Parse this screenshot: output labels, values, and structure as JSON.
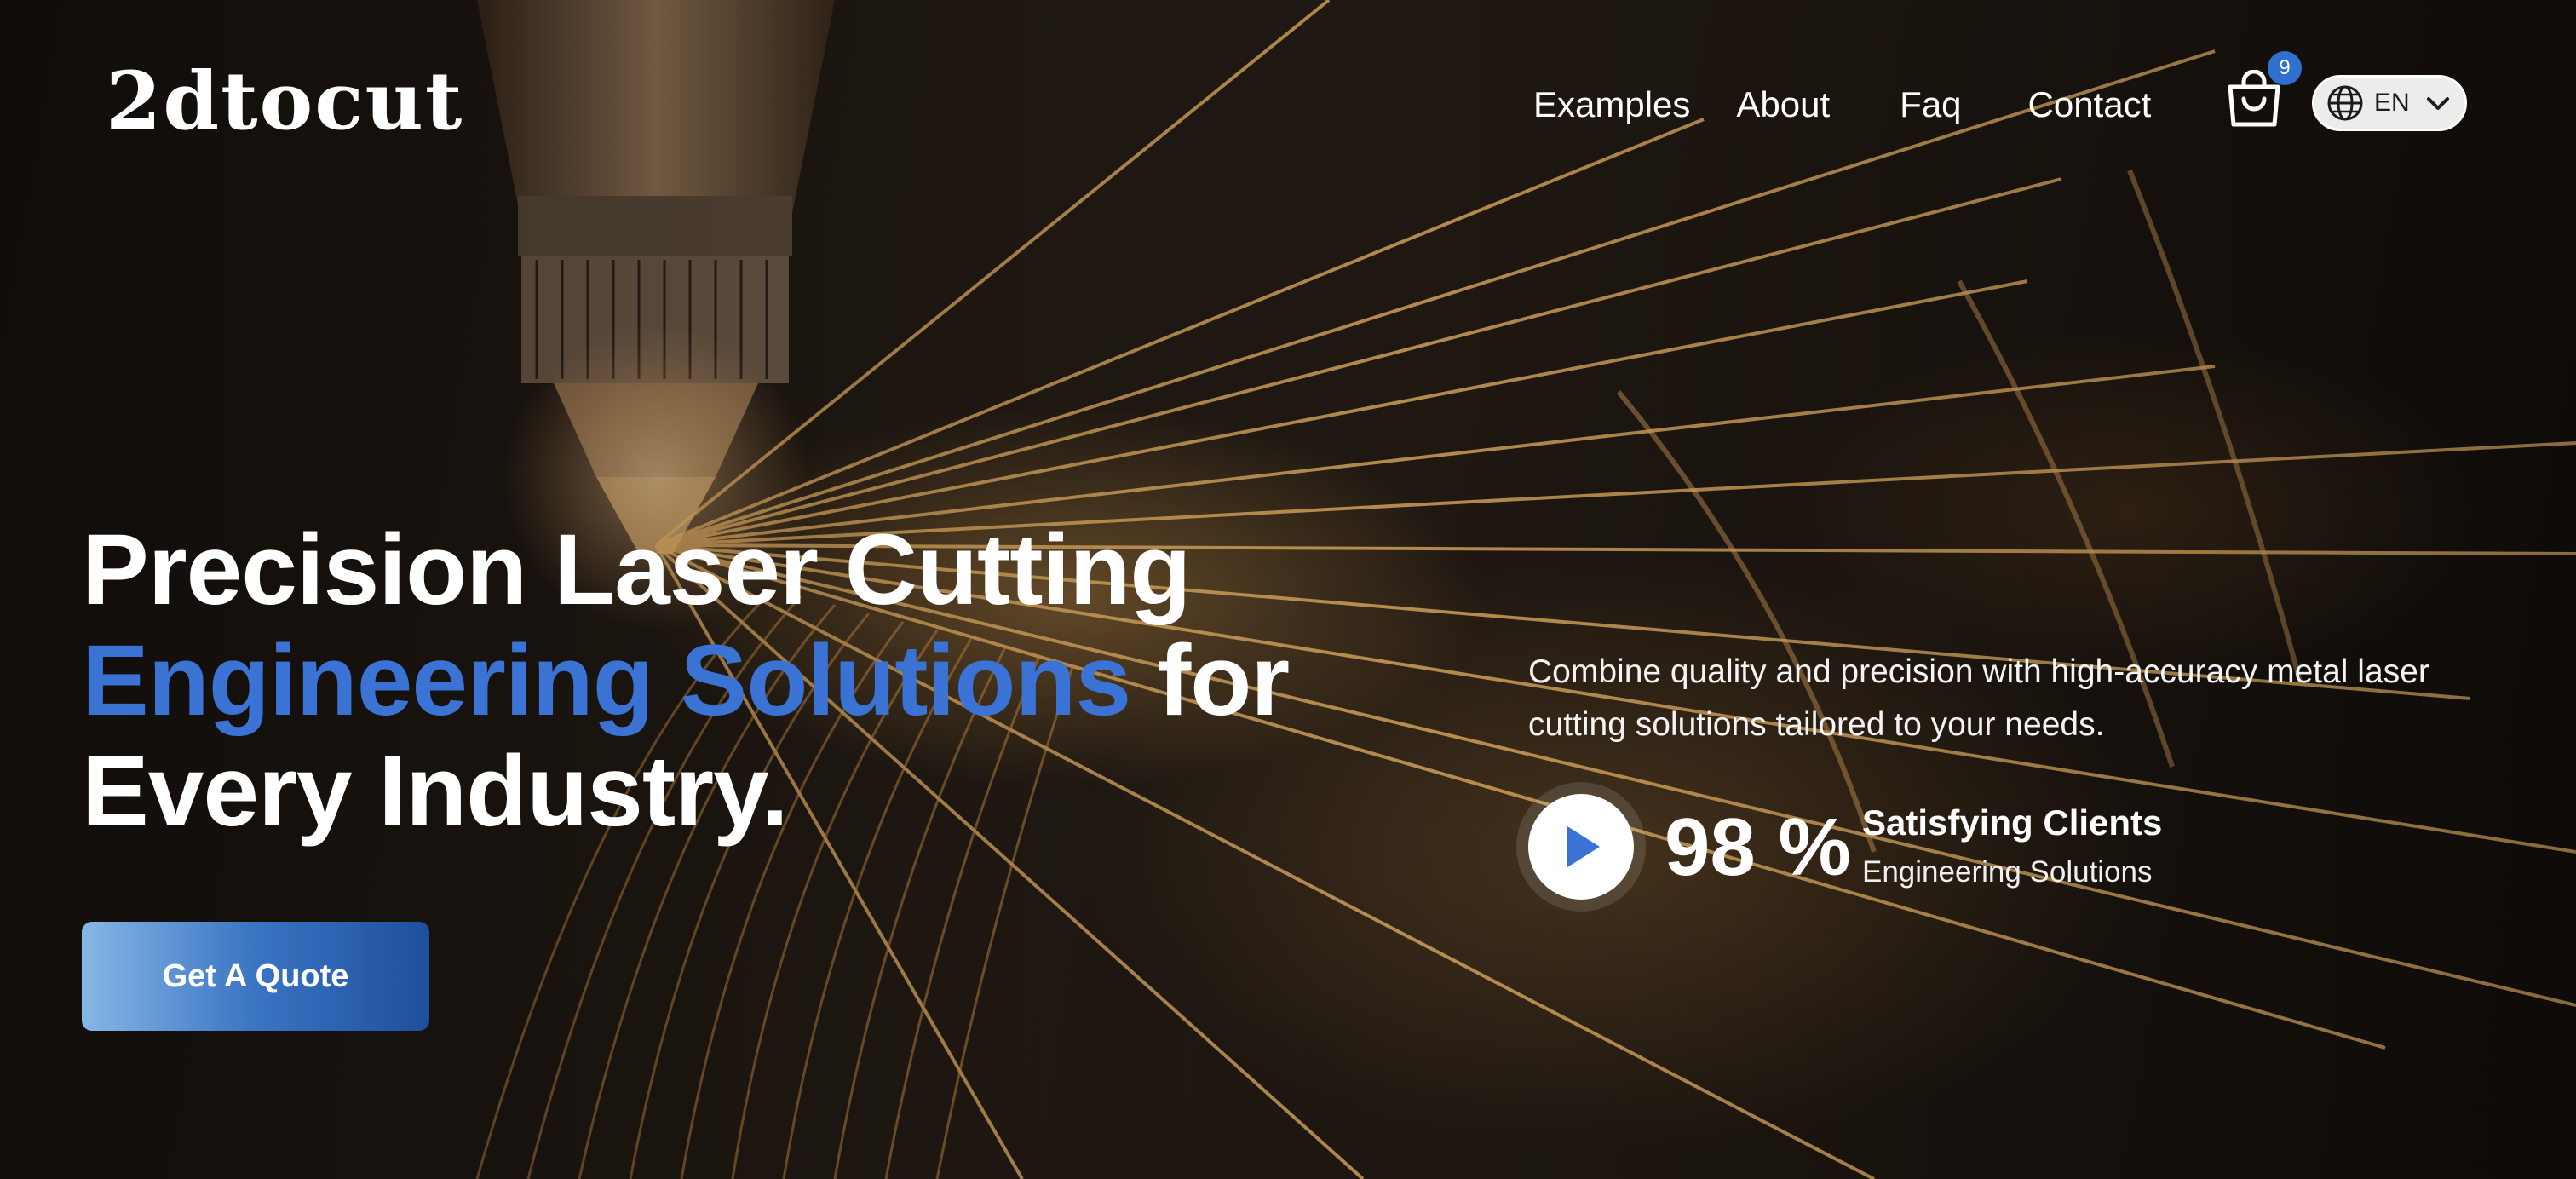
{
  "header": {
    "logo_text": "2dtocut",
    "nav": [
      {
        "label": "Examples"
      },
      {
        "label": "About"
      },
      {
        "label": "Faq"
      },
      {
        "label": "Contact"
      }
    ],
    "cart_count": "9",
    "language": {
      "code": "EN"
    }
  },
  "hero": {
    "headline_line1": "Precision Laser Cutting",
    "headline_accent": "Engineering Solutions",
    "headline_line2_rest": "for",
    "headline_line3": "Every Industry.",
    "cta_label": "Get A Quote",
    "description": "Combine quality and precision with high-accuracy metal laser cutting solutions tailored to your needs.",
    "stat": {
      "value": "98 %",
      "title": "Satisfying Clients",
      "subtitle": "Engineering Solutions"
    }
  },
  "colors": {
    "accent": "#3a73d4",
    "badge": "#2f6fd0",
    "cta_gradient_start": "#86b7e6",
    "cta_gradient_end": "#1e4f9e"
  },
  "icons": [
    "shopping-bag-icon",
    "globe-icon",
    "chevron-down-icon",
    "play-icon"
  ]
}
